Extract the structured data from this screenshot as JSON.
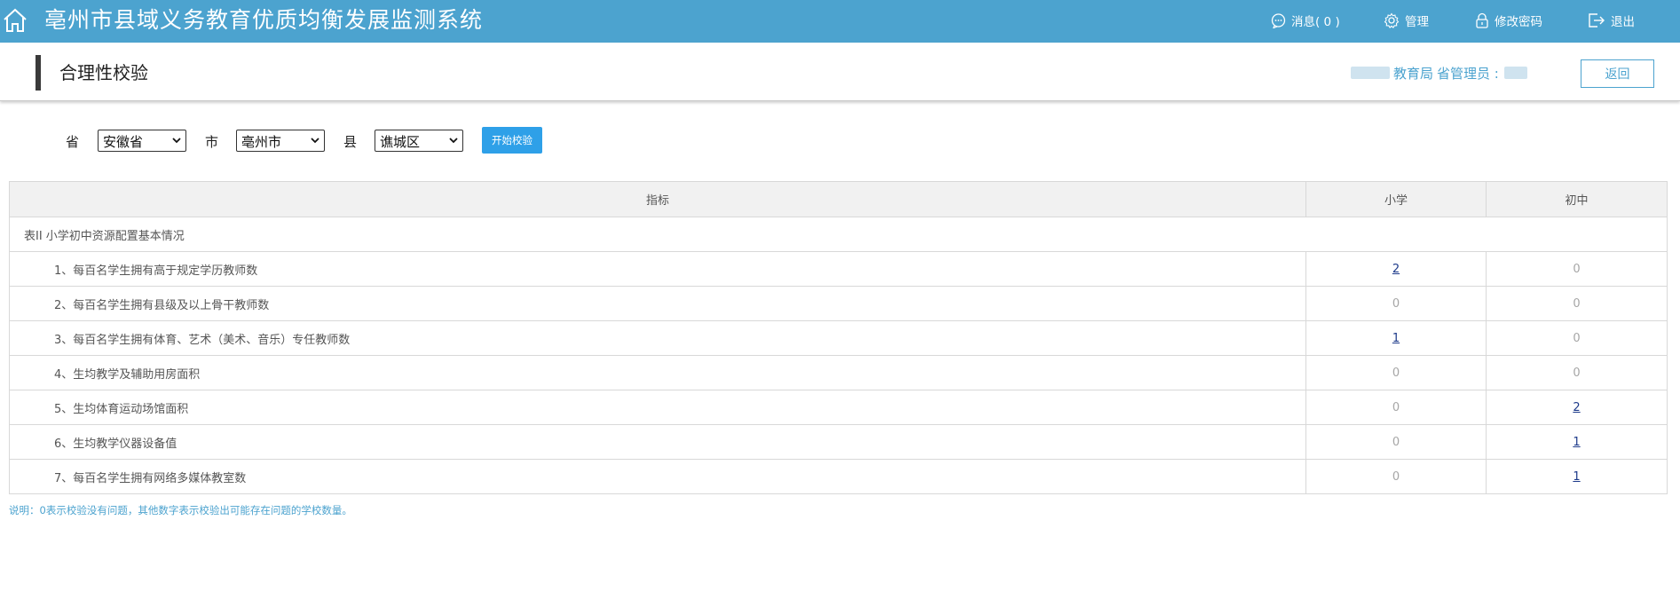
{
  "header": {
    "app_title": "亳州市县域义务教育优质均衡发展监测系统",
    "nav": {
      "messages_label": "消息( 0 )",
      "manage_label": "管理",
      "change_password_label": "修改密码",
      "logout_label": "退出"
    }
  },
  "page": {
    "title": "合理性校验",
    "user_org": "教育局",
    "user_role": "省管理员 :",
    "back_label": "返回"
  },
  "filters": {
    "province_label": "省",
    "province_value": "安徽省",
    "city_label": "市",
    "city_value": "亳州市",
    "county_label": "县",
    "county_value": "谯城区",
    "start_label": "开始校验"
  },
  "table": {
    "headers": [
      "指标",
      "小学",
      "初中"
    ],
    "section": "表II 小学初中资源配置基本情况",
    "rows": [
      {
        "indicator": "1、每百名学生拥有高于规定学历教师数",
        "primary": "2",
        "junior": "0"
      },
      {
        "indicator": "2、每百名学生拥有县级及以上骨干教师数",
        "primary": "0",
        "junior": "0"
      },
      {
        "indicator": "3、每百名学生拥有体育、艺术（美术、音乐）专任教师数",
        "primary": "1",
        "junior": "0"
      },
      {
        "indicator": "4、生均教学及辅助用房面积",
        "primary": "0",
        "junior": "0"
      },
      {
        "indicator": "5、生均体育运动场馆面积",
        "primary": "0",
        "junior": "2"
      },
      {
        "indicator": "6、生均教学仪器设备值",
        "primary": "0",
        "junior": "1"
      },
      {
        "indicator": "7、每百名学生拥有网络多媒体教室数",
        "primary": "0",
        "junior": "1"
      }
    ]
  },
  "footnote": "说明：0表示校验没有问题，其他数字表示校验出可能存在问题的学校数量。",
  "colors": {
    "topbar": "#4ca3cf",
    "accent_button": "#2ea0e8",
    "link": "#1d3a8a",
    "zero_value": "#a6a6a6"
  }
}
